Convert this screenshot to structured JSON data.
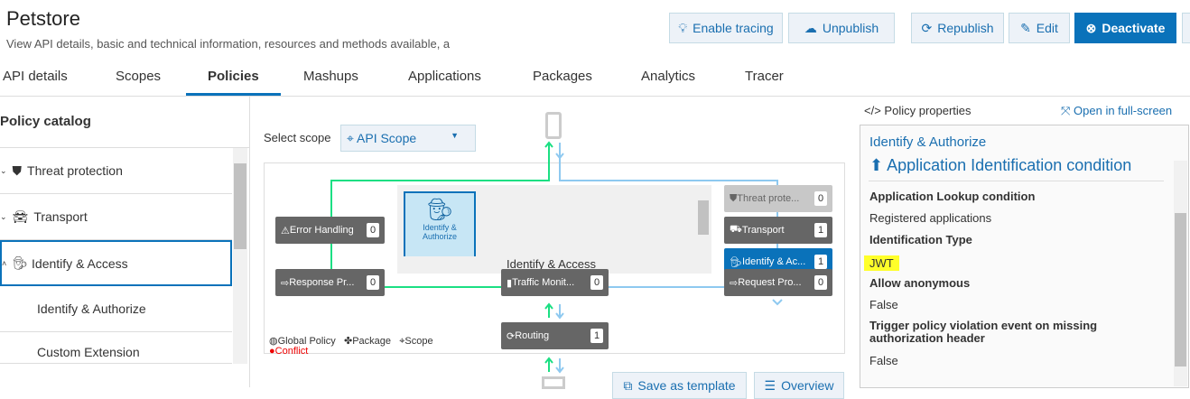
{
  "header": {
    "title": "Petstore",
    "subtitle": "View API details, basic and technical information, resources and methods available, a"
  },
  "toolbar": {
    "enable_tracing": "Enable tracing",
    "unpublish": "Unpublish",
    "republish": "Republish",
    "edit": "Edit",
    "deactivate": "Deactivate"
  },
  "tabs": [
    "API details",
    "Scopes",
    "Policies",
    "Mashups",
    "Applications",
    "Packages",
    "Analytics",
    "Tracer"
  ],
  "catalog": {
    "title": "Policy catalog",
    "items": [
      "Threat protection",
      "Transport",
      "Identify & Access",
      "Identify & Authorize",
      "Custom Extension"
    ]
  },
  "diagram": {
    "select_scope_label": "Select scope",
    "scope_value": "API Scope",
    "stage_title": "Identify & Access",
    "selected_policy": "Identify & Authorize",
    "nodes": {
      "error": {
        "label": "Error Handling",
        "count": "0"
      },
      "response": {
        "label": "Response Pr...",
        "count": "0"
      },
      "traffic": {
        "label": "Traffic Monit...",
        "count": "0"
      },
      "routing": {
        "label": "Routing",
        "count": "1"
      },
      "threat": {
        "label": "Threat prote...",
        "count": "0"
      },
      "transport": {
        "label": "Transport",
        "count": "1"
      },
      "identify": {
        "label": "Identify & Ac...",
        "count": "1"
      },
      "request": {
        "label": "Request Pro...",
        "count": "0"
      }
    },
    "legend": {
      "global": "Global Policy",
      "package": "Package",
      "scope": "Scope",
      "conflict": "Conflict"
    },
    "save_template": "Save as template",
    "overview": "Overview"
  },
  "properties": {
    "header": "Policy properties",
    "fullscreen": "Open in full-screen",
    "policy_title": "Identify & Authorize",
    "section": "Application Identification condition",
    "fields": [
      {
        "label": "Application Lookup condition",
        "value": "Registered applications"
      },
      {
        "label": "Identification Type",
        "value": "JWT"
      },
      {
        "label": "Allow anonymous",
        "value": "False"
      },
      {
        "label": "Trigger policy violation event on missing authorization header",
        "value": "False"
      }
    ]
  }
}
